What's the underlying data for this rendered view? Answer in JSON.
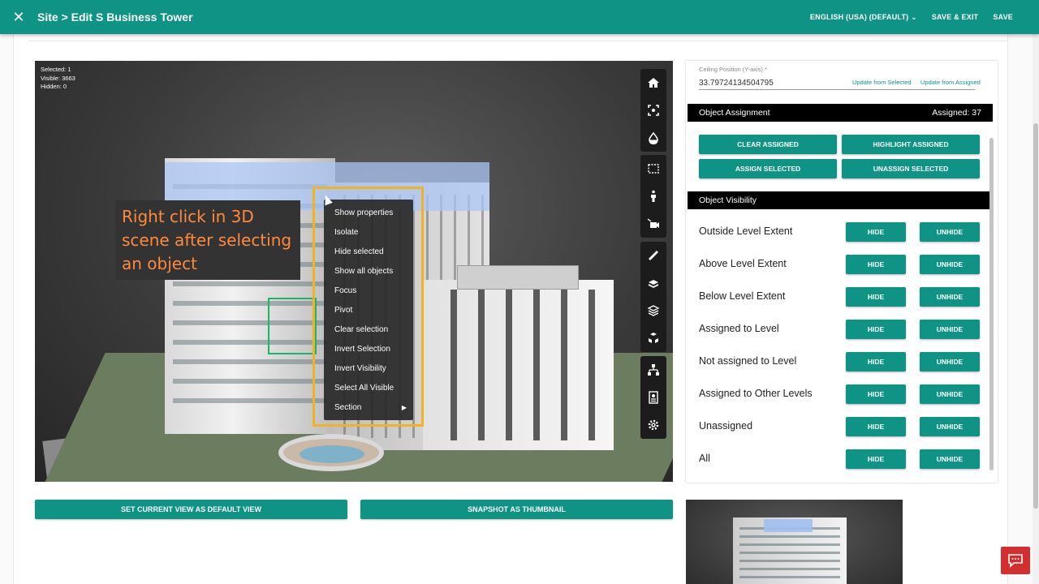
{
  "header": {
    "title": "Site > Edit S Business Tower",
    "language": "ENGLISH (USA) (DEFAULT)",
    "save_exit": "SAVE & EXIT",
    "save": "SAVE"
  },
  "viewer": {
    "stats": {
      "selected": "Selected: 1",
      "visible": "Visible: 3663",
      "hidden": "Hidden: 0"
    },
    "callout": "Right click in 3D scene after selecting an object",
    "context_menu": [
      "Show properties",
      "Isolate",
      "Hide selected",
      "Show all objects",
      "Focus",
      "Pivot",
      "Clear selection",
      "Invert Selection",
      "Invert Visibility",
      "Select All Visible",
      "Section"
    ]
  },
  "actions": {
    "default_view": "SET CURRENT VIEW AS DEFAULT VIEW",
    "snapshot": "SNAPSHOT AS THUMBNAIL"
  },
  "panel": {
    "ceiling": {
      "label": "Ceiling Position (Y-axis) *",
      "value": "33.79724134504795",
      "update_selected": "Update from Selected",
      "update_assigned": "Update from Assigned"
    },
    "assignment": {
      "title": "Object Assignment",
      "count": "Assigned: 37",
      "buttons": {
        "clear": "CLEAR ASSIGNED",
        "highlight": "HIGHLIGHT ASSIGNED",
        "assign": "ASSIGN SELECTED",
        "unassign": "UNASSIGN SELECTED"
      }
    },
    "visibility": {
      "title": "Object Visibility",
      "hide_label": "HIDE",
      "unhide_label": "UNHIDE",
      "rows": [
        "Outside Level Extent",
        "Above Level Extent",
        "Below Level Extent",
        "Assigned to Level",
        "Not assigned to Level",
        "Assigned to Other Levels",
        "Unassigned",
        "All"
      ]
    }
  },
  "colors": {
    "accent": "#0e9384",
    "highlight": "#f0b323",
    "callout_text": "#ff8a3d",
    "chat": "#d32f2f"
  }
}
